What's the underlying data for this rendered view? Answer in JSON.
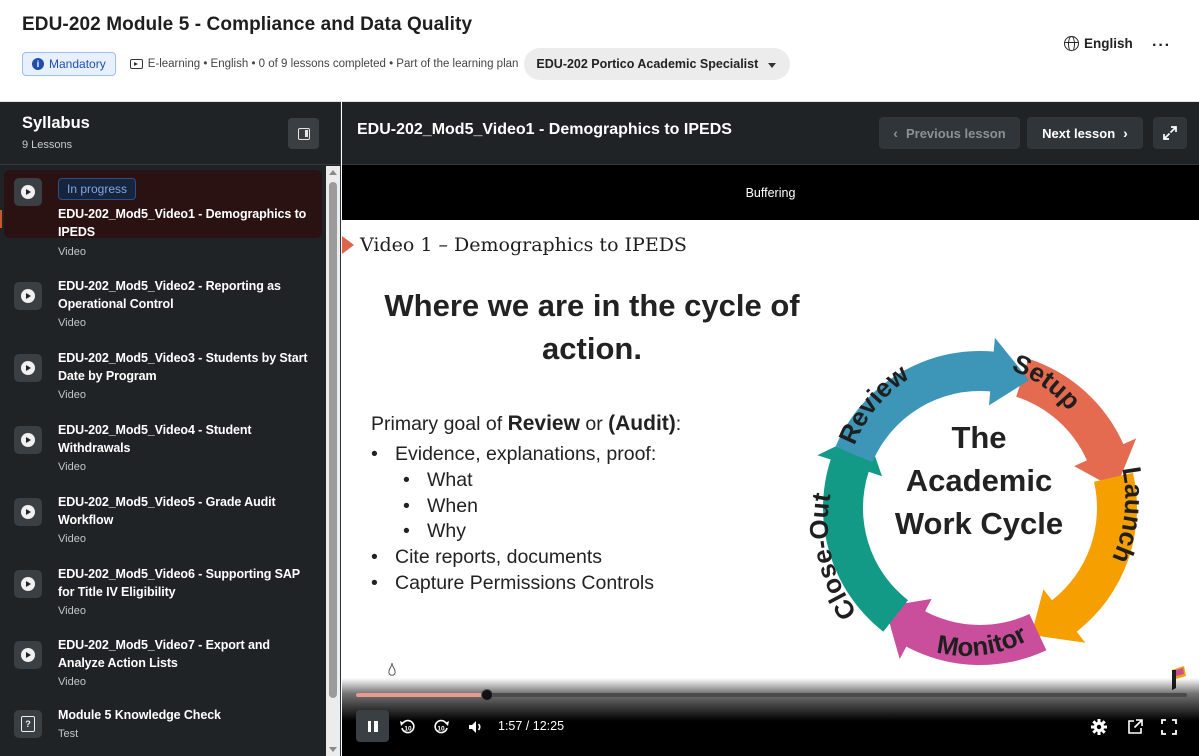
{
  "header": {
    "course_title": "EDU-202 Module 5 - Compliance and Data Quality",
    "mandatory_label": "Mandatory",
    "meta": "E-learning • English • 0 of 9 lessons completed • Part of the learning plan",
    "learning_plan": "EDU-202 Portico Academic Specialist",
    "language": "English"
  },
  "sidebar": {
    "title": "Syllabus",
    "count": "9 Lessons",
    "lessons": [
      {
        "title": "EDU-202_Mod5_Video1 - Demographics to IPEDS",
        "type": "Video",
        "badge": "In progress"
      },
      {
        "title": "EDU-202_Mod5_Video2 - Reporting as Operational Control",
        "type": "Video"
      },
      {
        "title": "EDU-202_Mod5_Video3 - Students by Start Date by Program",
        "type": "Video"
      },
      {
        "title": "EDU-202_Mod5_Video4 - Student Withdrawals",
        "type": "Video"
      },
      {
        "title": "EDU-202_Mod5_Video5 - Grade Audit Workflow",
        "type": "Video"
      },
      {
        "title": "EDU-202_Mod5_Video6 - Supporting SAP for Title IV Eligibility",
        "type": "Video"
      },
      {
        "title": "EDU-202_Mod5_Video7 - Export and Analyze Action Lists",
        "type": "Video"
      },
      {
        "title": "Module 5 Knowledge Check",
        "type": "Test"
      }
    ]
  },
  "content": {
    "lesson_title": "EDU-202_Mod5_Video1 - Demographics to IPEDS",
    "prev_label": "Previous lesson",
    "next_label": "Next lesson"
  },
  "video": {
    "buffer_text": "Buffering",
    "slide": {
      "subtitle": "Video 1 – Demographics to IPEDS",
      "headline_1": "Where we are in the cycle of",
      "headline_2": "action.",
      "goal_prefix": "Primary goal of ",
      "goal_review": "Review",
      "goal_or": " or ",
      "goal_audit": "(Audit)",
      "goal_colon": ":",
      "bullets": [
        "Evidence, explanations, proof:",
        "What",
        "When",
        "Why",
        "Cite reports, documents",
        "Capture Permissions Controls"
      ],
      "cycle_center_1": "The",
      "cycle_center_2": "Academic",
      "cycle_center_3": "Work Cycle",
      "cycle_stages": [
        "Setup",
        "Launch",
        "Monitor",
        "Close-Out",
        "Review"
      ]
    },
    "time": "1:57 / 12:25",
    "progress_fraction": 0.158
  },
  "colors": {
    "setup": "#e46a50",
    "launch": "#f5a000",
    "monitor": "#c94f9c",
    "closeout": "#129a86",
    "review": "#3d95b8",
    "accent": "#c85a2a",
    "progress": "#e79b8f"
  },
  "icons": [
    "info-icon",
    "elearning-icon",
    "globe-icon",
    "more-icon",
    "collapse-sidebar-icon",
    "play-icon",
    "test-icon",
    "expand-icon",
    "pause-icon",
    "rewind-10-icon",
    "forward-10-icon",
    "volume-icon",
    "settings-icon",
    "popout-icon",
    "fullscreen-icon"
  ]
}
